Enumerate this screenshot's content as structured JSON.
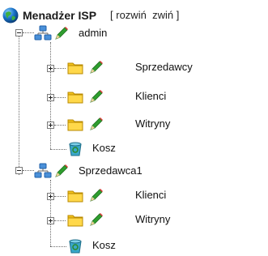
{
  "header": {
    "title": "Menadżer ISP",
    "bracket_open": "[",
    "expand_label": "rozwiń",
    "collapse_label": "zwiń",
    "bracket_close": "]"
  },
  "tree": [
    {
      "label": "admin",
      "expanded": true,
      "children": [
        {
          "label": "Sprzedawcy",
          "type": "folder"
        },
        {
          "label": "Klienci",
          "type": "folder"
        },
        {
          "label": "Witryny",
          "type": "folder"
        },
        {
          "label": "Kosz",
          "type": "trash"
        }
      ]
    },
    {
      "label": "Sprzedawca1",
      "expanded": true,
      "children": [
        {
          "label": "Klienci",
          "type": "folder"
        },
        {
          "label": "Witryny",
          "type": "folder"
        },
        {
          "label": "Kosz",
          "type": "trash"
        }
      ]
    }
  ],
  "colors": {
    "tree_line": "#6b6b6b",
    "folder": "#f2c21b",
    "pencil": "#2f9e2f",
    "globe": "#1a73c9"
  }
}
